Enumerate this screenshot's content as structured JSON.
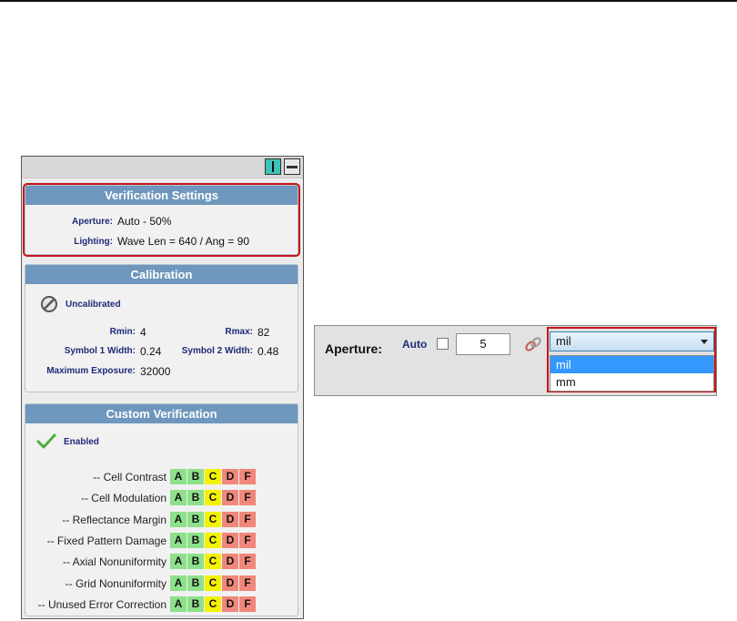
{
  "verification_settings": {
    "title": "Verification Settings",
    "aperture_label": "Aperture:",
    "aperture_value": "Auto - 50%",
    "lighting_label": "Lighting:",
    "lighting_value": "Wave Len = 640 / Ang = 90"
  },
  "calibration": {
    "title": "Calibration",
    "status": "Uncalibrated",
    "rmin_label": "Rmin:",
    "rmin_value": "4",
    "rmax_label": "Rmax:",
    "rmax_value": "82",
    "sym1_label": "Symbol 1 Width:",
    "sym1_value": "0.24",
    "sym2_label": "Symbol 2 Width:",
    "sym2_value": "0.48",
    "maxexp_label": "Maximum Exposure:",
    "maxexp_value": "32000"
  },
  "custom_verification": {
    "title": "Custom Verification",
    "status": "Enabled",
    "grades": [
      "A",
      "B",
      "C",
      "D",
      "F"
    ],
    "rows": [
      "-- Cell Contrast",
      "-- Cell Modulation",
      "-- Reflectance Margin",
      "-- Fixed Pattern Damage",
      "-- Axial Nonuniformity",
      "-- Grid Nonuniformity",
      "-- Unused Error Correction"
    ]
  },
  "aperture_control": {
    "label": "Aperture:",
    "auto_label": "Auto",
    "auto_checked": false,
    "value": "5",
    "unit_selected": "mil",
    "unit_options": [
      "mil",
      "mm"
    ]
  },
  "colors": {
    "section_header": "#6f97bd",
    "highlight": "#c8131b",
    "grade_green": "#8ee08a",
    "grade_yellow": "#f5f200",
    "grade_red": "#f0877a"
  }
}
